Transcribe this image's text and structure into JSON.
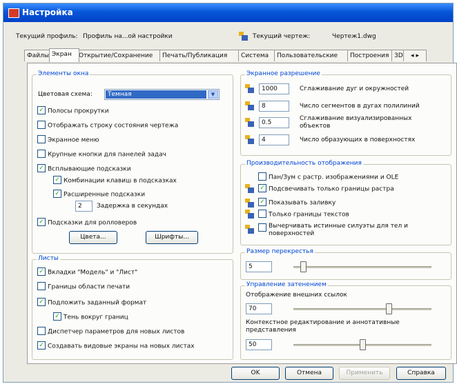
{
  "window": {
    "title": "Настройка"
  },
  "profile": {
    "label": "Текущий профиль:",
    "value": "Профиль на...ой настройки"
  },
  "drawing": {
    "label": "Текущий чертеж:",
    "value": "Чертеж1.dwg"
  },
  "tabs": [
    "Файлы",
    "Экран",
    "Открытие/Сохранение",
    "Печать/Публикация",
    "Система",
    "Пользовательские",
    "Построения",
    "3D"
  ],
  "active_tab": "Экран",
  "window_elements": {
    "title": "Элементы окна",
    "color_scheme_label": "Цветовая схема:",
    "color_scheme_value": "Темная",
    "checkboxes": [
      {
        "label": "Полосы прокрутки",
        "checked": true
      },
      {
        "label": "Отображать строку состояния чертежа",
        "checked": false
      },
      {
        "label": "Экранное меню",
        "checked": false
      },
      {
        "label": "Крупные кнопки для панелей задач",
        "checked": false
      },
      {
        "label": "Всплывающие подсказки",
        "checked": true
      },
      {
        "label": "Комбинации клавиш в подсказках",
        "checked": true
      },
      {
        "label": "Расширенные подсказки",
        "checked": true
      },
      {
        "label": "Подсказки для ролловеров",
        "checked": true
      }
    ],
    "delay_value": "2",
    "delay_label": "Задержка в секундах",
    "colors_button": "Цвета...",
    "fonts_button": "Шрифты..."
  },
  "sheets": {
    "title": "Листы",
    "checkboxes": [
      {
        "label": "Вкладки \"Модель\" и \"Лист\"",
        "checked": true
      },
      {
        "label": "Границы области печати",
        "checked": false
      },
      {
        "label": "Подложить заданный формат",
        "checked": true
      },
      {
        "label": "Тень вокруг границ",
        "checked": true
      },
      {
        "label": "Диспетчер параметров для новых листов",
        "checked": false
      },
      {
        "label": "Создавать видовые экраны на новых листах",
        "checked": true
      }
    ]
  },
  "resolution": {
    "title": "Экранное разрешение",
    "rows": [
      {
        "value": "1000",
        "label": "Сглаживание дуг и окружностей"
      },
      {
        "value": "8",
        "label": "Число сегментов в дугах полилиний"
      },
      {
        "value": "0.5",
        "label": "Сглаживание визуализированных объектов"
      },
      {
        "value": "4",
        "label": "Число образующих в поверхностях"
      }
    ]
  },
  "performance": {
    "title": "Производительность отображения",
    "checkboxes": [
      {
        "label": "Пан/Зум с растр. изображениями и OLE",
        "checked": false
      },
      {
        "label": "Подсвечивать только границы растра",
        "checked": true
      },
      {
        "label": "Показывать заливку",
        "checked": true
      },
      {
        "label": "Только границы текстов",
        "checked": false
      },
      {
        "label": "Вычерчивать истинные силуэты для тел и поверхностей",
        "checked": false
      }
    ]
  },
  "crosshair": {
    "title": "Размер перекрестья",
    "value": "5",
    "slider_level_pct": 5
  },
  "fade": {
    "title": "Управление затенением",
    "xref_label": "Отображение внешних ссылок",
    "xref_value": "70",
    "xref_level_pct": 70,
    "inplace_label": "Контекстное редактирование и аннотативные представления",
    "inplace_value": "50",
    "inplace_level_pct": 50
  },
  "buttons": {
    "ok": "OK",
    "cancel": "Отмена",
    "apply": "Применить",
    "help": "Справка"
  },
  "accent": "#0046d5"
}
